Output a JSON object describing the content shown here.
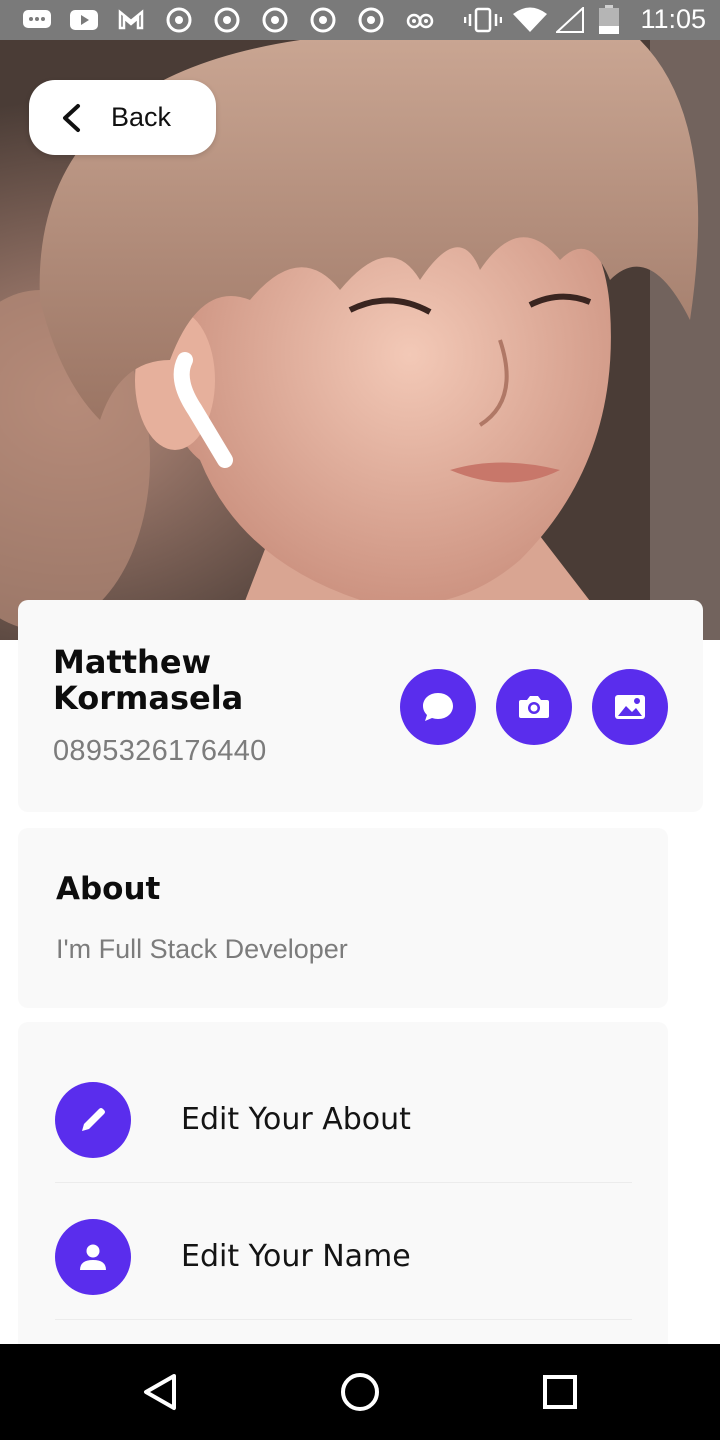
{
  "status_bar": {
    "time": "11:05",
    "icons": [
      "messages-icon",
      "youtube-icon",
      "gmail-icon",
      "chrome-icon",
      "chrome-icon",
      "chrome-icon",
      "chrome-icon",
      "chrome-icon",
      "tripadvisor-icon",
      "vibrate-icon",
      "wifi-icon",
      "signal-icon",
      "battery-icon"
    ]
  },
  "header": {
    "back_label": "Back"
  },
  "profile": {
    "name": "Matthew Kormasela",
    "phone": "0895326176440"
  },
  "quick_actions": [
    {
      "icon": "chat-icon",
      "name": "chat-button"
    },
    {
      "icon": "camera-icon",
      "name": "camera-button"
    },
    {
      "icon": "gallery-icon",
      "name": "gallery-button"
    }
  ],
  "about": {
    "title": "About",
    "text": "I'm Full Stack Developer"
  },
  "actions": [
    {
      "label": "Edit Your About",
      "icon": "pencil-icon"
    },
    {
      "label": "Edit Your Name",
      "icon": "person-icon"
    }
  ],
  "colors": {
    "accent": "#5a2ded",
    "status_bar": "#7a7a7a",
    "nav_bar": "#000000"
  }
}
